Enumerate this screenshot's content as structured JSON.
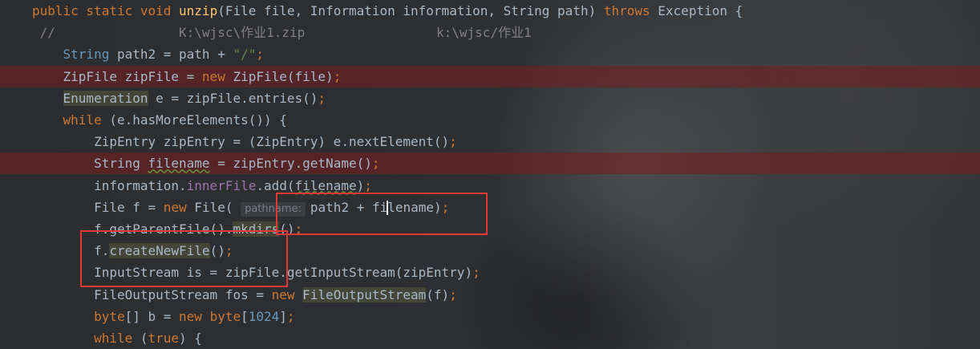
{
  "lines": [
    [
      {
        "t": "public static void ",
        "c": "kw"
      },
      {
        "t": "unzip",
        "c": "fn"
      },
      {
        "t": "(File file, Information information, String path) ",
        "c": "ty"
      },
      {
        "t": "throws ",
        "c": "kw"
      },
      {
        "t": "Exception {",
        "c": "ty"
      }
    ],
    [
      {
        "t": " //                K:\\wjsc\\作业1.zip                 k:\\wjsc/作业1",
        "c": "cm"
      }
    ],
    [
      {
        "t": "    ",
        "c": "ty"
      },
      {
        "t": "String",
        "c": "ty-b"
      },
      {
        "t": " path2 = path + ",
        "c": "ty"
      },
      {
        "t": "\"/\"",
        "c": "str"
      },
      {
        "t": ";",
        "c": "kw"
      }
    ],
    [
      {
        "t": "    ZipFile zipFile = ",
        "c": "ty"
      },
      {
        "t": "new ",
        "c": "kw"
      },
      {
        "t": "ZipFile(file)",
        "c": "ty"
      },
      {
        "t": ";",
        "c": "kw"
      }
    ],
    [
      {
        "t": "    ",
        "c": "ty"
      },
      {
        "t": "Enumeration",
        "c": "ty hl"
      },
      {
        "t": " e = zipFile.entries()",
        "c": "ty"
      },
      {
        "t": ";",
        "c": "kw"
      }
    ],
    [
      {
        "t": "    ",
        "c": "ty"
      },
      {
        "t": "while ",
        "c": "kw"
      },
      {
        "t": "(e.hasMoreElements()) {",
        "c": "ty"
      }
    ],
    [
      {
        "t": "        ZipEntry zipEntry = (ZipEntry) e.nextElement()",
        "c": "ty"
      },
      {
        "t": ";",
        "c": "kw"
      }
    ],
    [
      {
        "t": "        String ",
        "c": "ty"
      },
      {
        "t": "filename",
        "c": "ty und"
      },
      {
        "t": " = zipEntry.getName()",
        "c": "ty"
      },
      {
        "t": ";",
        "c": "kw"
      }
    ],
    [
      {
        "t": "        information.",
        "c": "ty"
      },
      {
        "t": "innerFile",
        "c": "fld"
      },
      {
        "t": ".add(",
        "c": "ty"
      },
      {
        "t": "filename",
        "c": "ty und"
      },
      {
        "t": ")",
        "c": "ty"
      },
      {
        "t": ";",
        "c": "kw"
      }
    ],
    [
      {
        "t": "        File f = ",
        "c": "ty"
      },
      {
        "t": "new ",
        "c": "kw"
      },
      {
        "t": "File( ",
        "c": "ty"
      },
      {
        "t": "pathname:",
        "c": "hint"
      },
      {
        "t": "path2 + fi",
        "c": "ty"
      },
      {
        "t": "",
        "c": "caret"
      },
      {
        "t": "lename)",
        "c": "ty"
      },
      {
        "t": ";",
        "c": "kw"
      }
    ],
    [
      {
        "t": "        f.getParentFile().",
        "c": "ty"
      },
      {
        "t": "mkdirs",
        "c": "ty hl"
      },
      {
        "t": "()",
        "c": "ty"
      },
      {
        "t": ";",
        "c": "kw"
      }
    ],
    [
      {
        "t": "        f.",
        "c": "ty"
      },
      {
        "t": "createNewFile",
        "c": "ty hl"
      },
      {
        "t": "()",
        "c": "ty"
      },
      {
        "t": ";",
        "c": "kw"
      }
    ],
    [
      {
        "t": "        InputStream is = zipFile.getInputStream(zipEntry)",
        "c": "ty"
      },
      {
        "t": ";",
        "c": "kw"
      }
    ],
    [
      {
        "t": "        FileOutputStream fos = ",
        "c": "ty"
      },
      {
        "t": "new ",
        "c": "kw"
      },
      {
        "t": "FileOutputStream",
        "c": "ty hl"
      },
      {
        "t": "(f)",
        "c": "ty"
      },
      {
        "t": ";",
        "c": "kw"
      }
    ],
    [
      {
        "t": "        ",
        "c": "ty"
      },
      {
        "t": "byte",
        "c": "kw"
      },
      {
        "t": "[] b = ",
        "c": "ty"
      },
      {
        "t": "new ",
        "c": "kw"
      },
      {
        "t": "byte",
        "c": "kw"
      },
      {
        "t": "[",
        "c": "ty"
      },
      {
        "t": "1024",
        "c": "num"
      },
      {
        "t": "]",
        "c": "ty"
      },
      {
        "t": ";",
        "c": "kw"
      }
    ],
    [
      {
        "t": "        ",
        "c": "ty"
      },
      {
        "t": "while ",
        "c": "kw"
      },
      {
        "t": "(",
        "c": "ty"
      },
      {
        "t": "true",
        "c": "kw"
      },
      {
        "t": ") {",
        "c": "ty"
      }
    ]
  ],
  "error_lines": [
    3,
    7
  ]
}
